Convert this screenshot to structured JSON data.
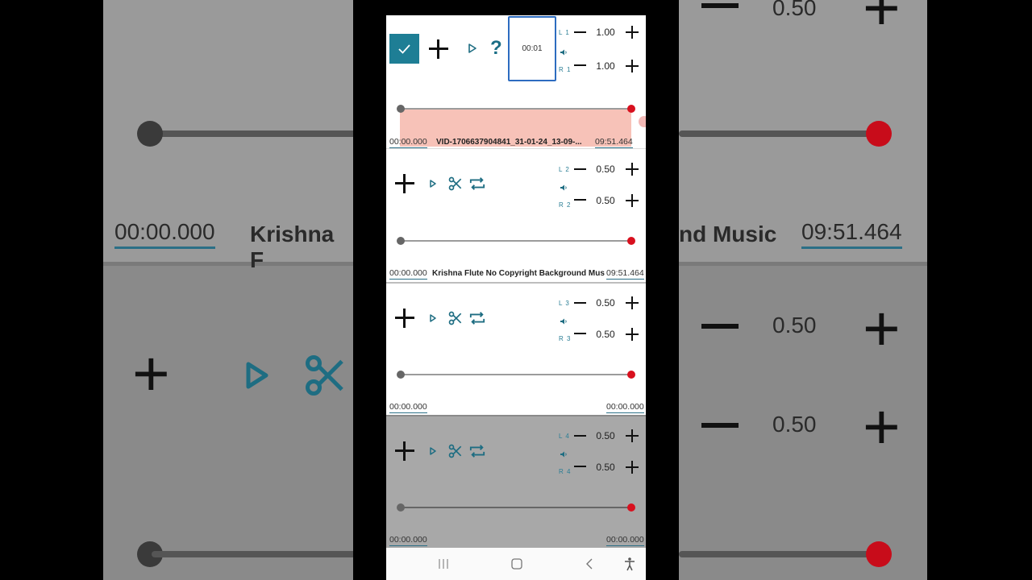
{
  "header": {
    "timestamp": "00:01",
    "help_symbol": "?"
  },
  "tracks": [
    {
      "left_label": "L 1",
      "right_label": "R 1",
      "left_volume": "1.00",
      "right_volume": "1.00",
      "start_time": "00:00.000",
      "file_name": "VID-1706637904841_31-01-24_13-09-...",
      "end_time": "09:51.464"
    },
    {
      "left_label": "L 2",
      "right_label": "R 2",
      "left_volume": "0.50",
      "right_volume": "0.50",
      "start_time": "00:00.000",
      "file_name": "Krishna Flute No Copyright Background Music",
      "end_time": "09:51.464"
    },
    {
      "left_label": "L 3",
      "right_label": "R 3",
      "left_volume": "0.50",
      "right_volume": "0.50",
      "start_time": "00:00.000",
      "file_name": "",
      "end_time": "00:00.000"
    },
    {
      "left_label": "L 4",
      "right_label": "R 4",
      "left_volume": "0.50",
      "right_volume": "0.50",
      "start_time": "00:00.000",
      "file_name": "",
      "end_time": "00:00.000"
    }
  ],
  "background_zoom": {
    "start_time": "00:00.000",
    "title_left": "Krishna F",
    "title_right": "nd Music",
    "end_time": "09:51.464",
    "top_volume": "0.50",
    "vol_a": "0.50",
    "vol_b": "0.50"
  },
  "colors": {
    "accent": "#1e7e95",
    "slider_end": "#d8101e",
    "waveform": "#f7c2b8",
    "selection_border": "#2d6cc0"
  },
  "icons": [
    "check-icon",
    "plus-icon",
    "play-icon",
    "help-icon",
    "speaker-icon",
    "scissors-icon",
    "repeat-icon",
    "recents-icon",
    "home-icon",
    "back-icon",
    "accessibility-icon"
  ]
}
